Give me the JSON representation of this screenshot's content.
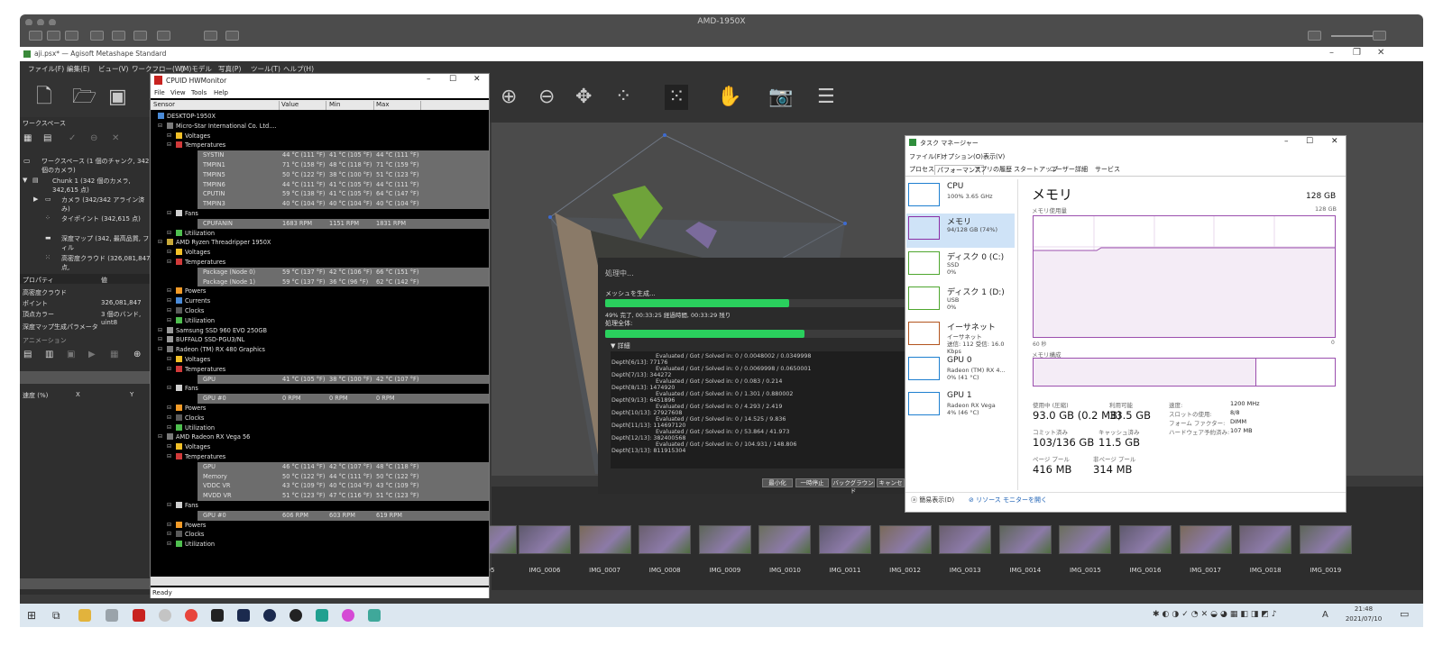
{
  "remote": {
    "title": "AMD-1950X"
  },
  "metashape": {
    "title": "aji.psx* — Agisoft Metashape Standard",
    "menu": [
      "ファイル(F)",
      "編集(E)",
      "ビュー(V)",
      "ワークフロー(W)",
      "(M)モデル",
      "写真(P)",
      "ツール(T)",
      "ヘルプ(H)"
    ],
    "workspace": {
      "header": "ワークスペース",
      "root": "ワークスペース (1 個のチャンク, 342 個のカメラ)",
      "chunk": "Chunk 1 (342 個のカメラ, 342,615 点)",
      "cameras": "カメラ (342/342 アライン済み)",
      "tie_points": "タイポイント (342,615 点)",
      "depth": "深度マップ (342, 最高品質, フィル",
      "dense": "高密度クラウド (326,081,847 点,"
    },
    "properties": {
      "col_prop": "プロパティ",
      "col_val": "値",
      "rows": [
        [
          "高密度クラウド",
          ""
        ],
        [
          "ポイント",
          "326,081,847"
        ],
        [
          "頂点カラー",
          "3 個のバンド, uint8"
        ],
        [
          "深度マップ生成パラメータ",
          ""
        ]
      ]
    },
    "animation": {
      "header": "アニメーション",
      "cols": [
        "速度 (%)",
        "X",
        "Y"
      ]
    },
    "photos": [
      "05",
      "IMG_0006",
      "IMG_0007",
      "IMG_0008",
      "IMG_0009",
      "IMG_0010",
      "IMG_0011",
      "IMG_0012",
      "IMG_0013",
      "IMG_0014",
      "IMG_0015",
      "IMG_0016",
      "IMG_0017",
      "IMG_0018",
      "IMG_0019"
    ]
  },
  "hwmonitor": {
    "title": "CPUID HWMonitor",
    "menu": [
      "File",
      "View",
      "Tools",
      "Help"
    ],
    "columns": [
      "Sensor",
      "Value",
      "Min",
      "Max"
    ],
    "status": "Ready",
    "rows": [
      {
        "t": "DESKTOP-1950X",
        "v": "",
        "mn": "",
        "mx": "",
        "lvl": 0,
        "k": "pc"
      },
      {
        "t": "Micro-Star International Co. Ltd....",
        "v": "",
        "mn": "",
        "mx": "",
        "lvl": 1,
        "k": "mb"
      },
      {
        "t": "Voltages",
        "v": "",
        "mn": "",
        "mx": "",
        "lvl": 2,
        "k": "volt"
      },
      {
        "t": "Temperatures",
        "v": "",
        "mn": "",
        "mx": "",
        "lvl": 2,
        "k": "temp"
      },
      {
        "t": "SYSTIN",
        "v": "44 °C (111 °F)",
        "mn": "41 °C (105 °F)",
        "mx": "44 °C (111 °F)",
        "lvl": 3,
        "hl": true
      },
      {
        "t": "TMPIN1",
        "v": "71 °C (158 °F)",
        "mn": "48 °C (118 °F)",
        "mx": "71 °C (159 °F)",
        "lvl": 3,
        "hl": true
      },
      {
        "t": "TMPIN5",
        "v": "50 °C (122 °F)",
        "mn": "38 °C (100 °F)",
        "mx": "51 °C (123 °F)",
        "lvl": 3,
        "hl": true
      },
      {
        "t": "TMPIN6",
        "v": "44 °C (111 °F)",
        "mn": "41 °C (105 °F)",
        "mx": "44 °C (111 °F)",
        "lvl": 3,
        "hl": true
      },
      {
        "t": "CPUTIN",
        "v": "59 °C (138 °F)",
        "mn": "41 °C (105 °F)",
        "mx": "64 °C (147 °F)",
        "lvl": 3,
        "hl": true
      },
      {
        "t": "TMPIN3",
        "v": "40 °C (104 °F)",
        "mn": "40 °C (104 °F)",
        "mx": "40 °C (104 °F)",
        "lvl": 3,
        "hl": true
      },
      {
        "t": "Fans",
        "v": "",
        "mn": "",
        "mx": "",
        "lvl": 2,
        "k": "fan"
      },
      {
        "t": "CPUFANIN",
        "v": "1683 RPM",
        "mn": "1151 RPM",
        "mx": "1831 RPM",
        "lvl": 3,
        "hl": true
      },
      {
        "t": "Utilization",
        "v": "",
        "mn": "",
        "mx": "",
        "lvl": 2,
        "k": "util"
      },
      {
        "t": "AMD Ryzen Threadripper 1950X",
        "v": "",
        "mn": "",
        "mx": "",
        "lvl": 1,
        "k": "cpu"
      },
      {
        "t": "Voltages",
        "v": "",
        "mn": "",
        "mx": "",
        "lvl": 2,
        "k": "volt"
      },
      {
        "t": "Temperatures",
        "v": "",
        "mn": "",
        "mx": "",
        "lvl": 2,
        "k": "temp"
      },
      {
        "t": "Package (Node 0)",
        "v": "59 °C (137 °F)",
        "mn": "42 °C (106 °F)",
        "mx": "66 °C (151 °F)",
        "lvl": 3,
        "hl": true
      },
      {
        "t": "Package (Node 1)",
        "v": "59 °C (137 °F)",
        "mn": "36 °C (96 °F)",
        "mx": "62 °C (142 °F)",
        "lvl": 3,
        "hl": true
      },
      {
        "t": "Powers",
        "v": "",
        "mn": "",
        "mx": "",
        "lvl": 2,
        "k": "pow"
      },
      {
        "t": "Currents",
        "v": "",
        "mn": "",
        "mx": "",
        "lvl": 2,
        "k": "cur"
      },
      {
        "t": "Clocks",
        "v": "",
        "mn": "",
        "mx": "",
        "lvl": 2,
        "k": "clk"
      },
      {
        "t": "Utilization",
        "v": "",
        "mn": "",
        "mx": "",
        "lvl": 2,
        "k": "util"
      },
      {
        "t": "Samsung SSD 960 EVO 250GB",
        "v": "",
        "mn": "",
        "mx": "",
        "lvl": 1,
        "k": "disk"
      },
      {
        "t": "BUFFALO SSD-PGU3/NL",
        "v": "",
        "mn": "",
        "mx": "",
        "lvl": 1,
        "k": "disk"
      },
      {
        "t": "Radeon (TM) RX 480 Graphics",
        "v": "",
        "mn": "",
        "mx": "",
        "lvl": 1,
        "k": "gpu"
      },
      {
        "t": "Voltages",
        "v": "",
        "mn": "",
        "mx": "",
        "lvl": 2,
        "k": "volt"
      },
      {
        "t": "Temperatures",
        "v": "",
        "mn": "",
        "mx": "",
        "lvl": 2,
        "k": "temp"
      },
      {
        "t": "GPU",
        "v": "41 °C (105 °F)",
        "mn": "38 °C (100 °F)",
        "mx": "42 °C (107 °F)",
        "lvl": 3,
        "hl": true
      },
      {
        "t": "Fans",
        "v": "",
        "mn": "",
        "mx": "",
        "lvl": 2,
        "k": "fan"
      },
      {
        "t": "GPU #0",
        "v": "0 RPM",
        "mn": "0 RPM",
        "mx": "0 RPM",
        "lvl": 3,
        "hl": true
      },
      {
        "t": "Powers",
        "v": "",
        "mn": "",
        "mx": "",
        "lvl": 2,
        "k": "pow"
      },
      {
        "t": "Clocks",
        "v": "",
        "mn": "",
        "mx": "",
        "lvl": 2,
        "k": "clk"
      },
      {
        "t": "Utilization",
        "v": "",
        "mn": "",
        "mx": "",
        "lvl": 2,
        "k": "util"
      },
      {
        "t": "AMD Radeon RX Vega 56",
        "v": "",
        "mn": "",
        "mx": "",
        "lvl": 1,
        "k": "gpu"
      },
      {
        "t": "Voltages",
        "v": "",
        "mn": "",
        "mx": "",
        "lvl": 2,
        "k": "volt"
      },
      {
        "t": "Temperatures",
        "v": "",
        "mn": "",
        "mx": "",
        "lvl": 2,
        "k": "temp"
      },
      {
        "t": "GPU",
        "v": "46 °C (114 °F)",
        "mn": "42 °C (107 °F)",
        "mx": "48 °C (118 °F)",
        "lvl": 3,
        "hl": true
      },
      {
        "t": "Memory",
        "v": "50 °C (122 °F)",
        "mn": "44 °C (111 °F)",
        "mx": "50 °C (122 °F)",
        "lvl": 3,
        "hl": true
      },
      {
        "t": "VDDC VR",
        "v": "43 °C (109 °F)",
        "mn": "40 °C (104 °F)",
        "mx": "43 °C (109 °F)",
        "lvl": 3,
        "hl": true
      },
      {
        "t": "MVDD VR",
        "v": "51 °C (123 °F)",
        "mn": "47 °C (116 °F)",
        "mx": "51 °C (123 °F)",
        "lvl": 3,
        "hl": true
      },
      {
        "t": "Fans",
        "v": "",
        "mn": "",
        "mx": "",
        "lvl": 2,
        "k": "fan"
      },
      {
        "t": "GPU #0",
        "v": "606 RPM",
        "mn": "603 RPM",
        "mx": "619 RPM",
        "lvl": 3,
        "hl": true
      },
      {
        "t": "Powers",
        "v": "",
        "mn": "",
        "mx": "",
        "lvl": 2,
        "k": "pow"
      },
      {
        "t": "Clocks",
        "v": "",
        "mn": "",
        "mx": "",
        "lvl": 2,
        "k": "clk"
      },
      {
        "t": "Utilization",
        "v": "",
        "mn": "",
        "mx": "",
        "lvl": 2,
        "k": "util"
      }
    ]
  },
  "processing": {
    "title": "処理中...",
    "task": "メッシュを生成...",
    "task_progress": 0.61,
    "progress_text": "49% 完了, 00:33:25 経過時間, 00:33:29 残り",
    "overall_label": "処理全体:",
    "overall_progress": 0.66,
    "details_label": "詳細",
    "log": [
      "Evaluated / Got / Solved in: 0 / 0.0048002 / 0.0349998",
      "Depth[6/13]: 77176",
      "Evaluated / Got / Solved in: 0 / 0.0069998 / 0.0650001",
      "Depth[7/13]: 344272",
      "Evaluated / Got / Solved in: 0 / 0.083 / 0.214",
      "Depth[8/13]: 1474920",
      "Evaluated / Got / Solved in: 0 / 1.301 / 0.880002",
      "Depth[9/13]: 6451896",
      "Evaluated / Got / Solved in: 0 / 4.293 / 2.419",
      "Depth[10/13]: 27927608",
      "Evaluated / Got / Solved in: 0 / 14.525 / 9.836",
      "Depth[11/13]: 114697120",
      "Evaluated / Got / Solved in: 0 / 53.864 / 41.973",
      "Depth[12/13]: 382400568",
      "Evaluated / Got / Solved in: 0 / 104.931 / 148.806",
      "Depth[13/13]: 811915304"
    ],
    "buttons": [
      "最小化",
      "一時停止",
      "バックグラウンド",
      "キャンセル"
    ]
  },
  "taskmgr": {
    "title": "タスク マネージャー",
    "menu": [
      "ファイル(F)",
      "オプション(O)",
      "表示(V)"
    ],
    "tabs": [
      "プロセス",
      "パフォーマンス",
      "アプリの履歴",
      "スタートアップ",
      "ユーザー",
      "詳細",
      "サービス"
    ],
    "sidebar": [
      {
        "name": "CPU",
        "l1": "100% 3.65 GHz",
        "l2": "",
        "color": "#1e7fd0"
      },
      {
        "name": "メモリ",
        "l1": "94/128 GB (74%)",
        "l2": "",
        "color": "#8b2ea6"
      },
      {
        "name": "ディスク 0 (C:)",
        "l1": "SSD",
        "l2": "0%",
        "color": "#4ea62e"
      },
      {
        "name": "ディスク 1 (D:)",
        "l1": "USB",
        "l2": "0%",
        "color": "#4ea62e"
      },
      {
        "name": "イーサネット",
        "l1": "イーサネット",
        "l2": "送信: 112 受信: 16.0 Kbps",
        "color": "#b3541e"
      },
      {
        "name": "GPU 0",
        "l1": "Radeon (TM) RX 4...",
        "l2": "0% (41 °C)",
        "color": "#1e7fd0"
      },
      {
        "name": "GPU 1",
        "l1": "Radeon RX Vega",
        "l2": "4% (46 °C)",
        "color": "#1e7fd0"
      }
    ],
    "heading": "メモリ",
    "total": "128 GB",
    "usage_label": "メモリ使用量",
    "usage_max": "128 GB",
    "axis_left": "60 秒",
    "axis_right": "0",
    "composition_label": "メモリ構成",
    "in_use_fraction": 0.74,
    "stats": {
      "inuse_l": "使用中 (圧縮)",
      "inuse_v": "93.0 GB (0.2 MB)",
      "avail_l": "利用可能",
      "avail_v": "33.5 GB",
      "commit_l": "コミット済み",
      "commit_v": "103/136 GB",
      "cache_l": "キャッシュ済み",
      "cache_v": "11.5 GB",
      "paged_l": "ページ プール",
      "paged_v": "416 MB",
      "nonpaged_l": "非ページ プール",
      "nonpaged_v": "314 MB",
      "speed_l": "速度:",
      "speed_v": "1200 MHz",
      "slots_l": "スロットの使用:",
      "slots_v": "8/8",
      "form_l": "フォーム ファクター:",
      "form_v": "DIMM",
      "hw_l": "ハードウェア予約済み:",
      "hw_v": "107 MB"
    },
    "footer_simple": "簡易表示(D)",
    "footer_link": "リソース モニターを開く"
  },
  "taskbar": {
    "time": "21:48",
    "date": "2021/07/10",
    "ime": "A"
  }
}
